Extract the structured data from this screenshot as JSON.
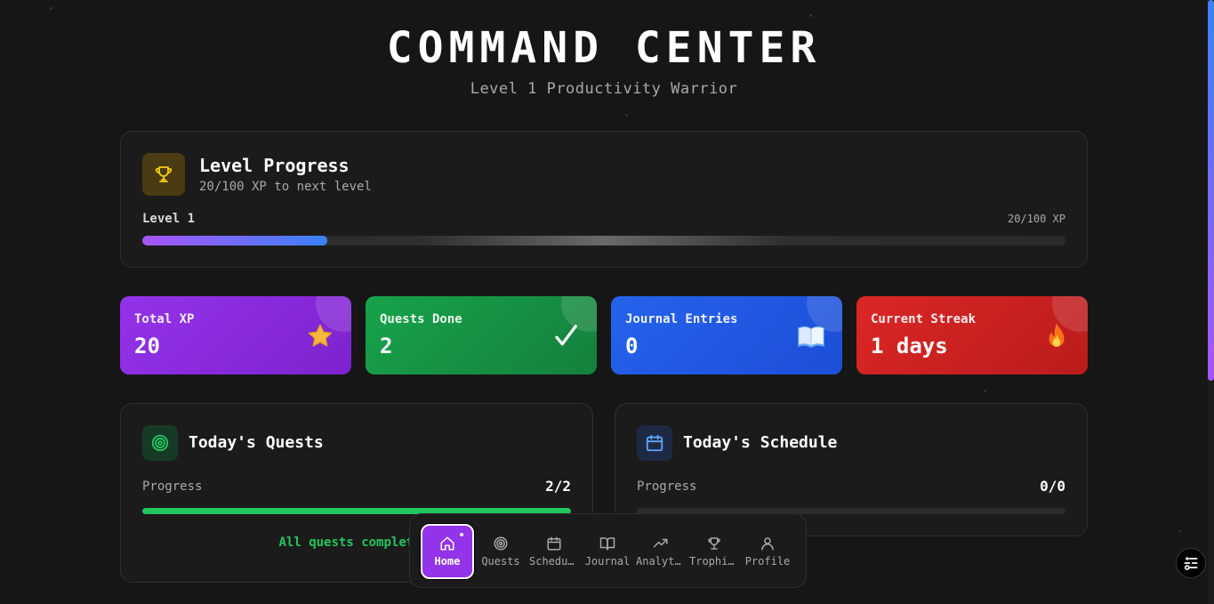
{
  "header": {
    "title": "COMMAND CENTER",
    "subtitle": "Level 1 Productivity Warrior"
  },
  "level_progress": {
    "title": "Level Progress",
    "subtitle": "20/100 XP to next level",
    "level_label": "Level 1",
    "xp_label": "20/100 XP",
    "progress": 0.2,
    "icon": "trophy-icon"
  },
  "stats": [
    {
      "label": "Total XP",
      "value": "20",
      "icon": "star-icon",
      "color": "#9333ea"
    },
    {
      "label": "Quests Done",
      "value": "2",
      "icon": "checkmark-icon",
      "color": "#16a34a"
    },
    {
      "label": "Journal Entries",
      "value": "0",
      "icon": "book-icon",
      "color": "#2563eb"
    },
    {
      "label": "Current Streak",
      "value": "1 days",
      "icon": "fire-icon",
      "color": "#dc2626"
    }
  ],
  "quests": {
    "title": "Today's Quests",
    "progress_label": "Progress",
    "count": "2/2",
    "progress": 1.0,
    "complete_message": "All quests completed!",
    "icon": "target-icon"
  },
  "schedule": {
    "title": "Today's Schedule",
    "progress_label": "Progress",
    "count": "0/0",
    "progress": 0,
    "icon": "calendar-icon"
  },
  "nav": {
    "items": [
      {
        "label": "Home",
        "icon": "home-icon",
        "active": true
      },
      {
        "label": "Quests",
        "icon": "target-icon"
      },
      {
        "label": "Schedule",
        "icon": "calendar-icon"
      },
      {
        "label": "Journal",
        "icon": "book-icon"
      },
      {
        "label": "Analytics",
        "icon": "trend-icon"
      },
      {
        "label": "Trophies",
        "icon": "trophy-icon"
      },
      {
        "label": "Profile",
        "icon": "user-icon"
      }
    ]
  },
  "colors": {
    "background": "#161616",
    "accent": "#9333ea",
    "success": "#22c55e"
  }
}
